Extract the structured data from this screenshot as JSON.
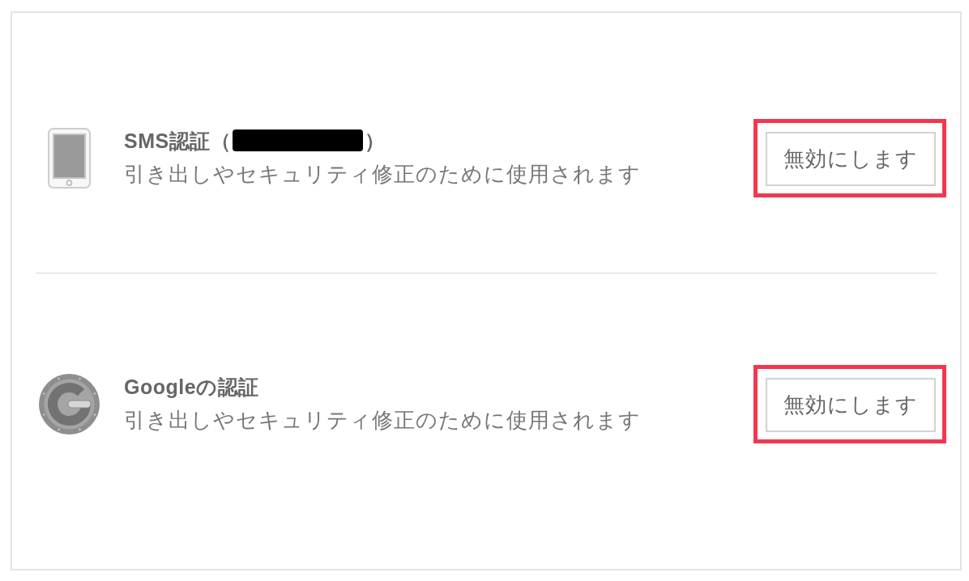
{
  "panel": {
    "methods": [
      {
        "kind": "phone",
        "title": "SMS認証（",
        "redacted": true,
        "title_end": "）",
        "description": "引き出しやセキュリティ修正のために使用されます",
        "button": "無効にします",
        "highlighted": true
      },
      {
        "kind": "authenticator",
        "title": "Googleの認証",
        "redacted": false,
        "description": "引き出しやセキュリティ修正のために使用されます",
        "button": "無効にします",
        "highlighted": true
      }
    ]
  }
}
